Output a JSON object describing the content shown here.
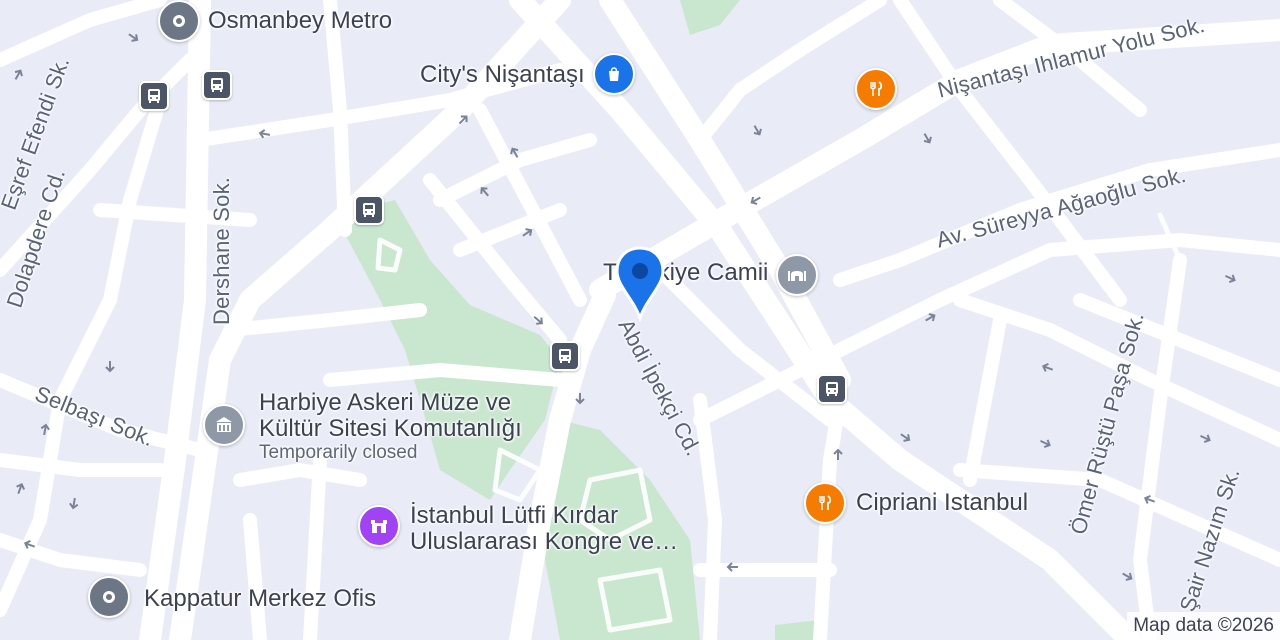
{
  "map": {
    "colors": {
      "background": "#e9ebf7",
      "road": "#ffffff",
      "park": "#c9e6cf",
      "marker": "#1a73e8",
      "transit": "#4b5565",
      "restaurant": "#f57c00",
      "shopping": "#1a73e8",
      "landmark": "#9e9e9e",
      "event_venue": "#a142f4",
      "place": "#6c7684"
    },
    "street_labels": [
      {
        "text": "Nişantaşı Ihlamur Yolu Sok."
      },
      {
        "text": "Av. Süreyya Ağaoğlu Sok."
      },
      {
        "text": "Eşref Efendi Sk."
      },
      {
        "text": "Dolapdere Cd."
      },
      {
        "text": "Dershane Sok."
      },
      {
        "text": "Selbaşı Sok."
      },
      {
        "text": "Abdi İpekçi Cd."
      },
      {
        "text": "Ömer Rüştü Paşa Sok."
      },
      {
        "text": "Şair Nazım Sk."
      }
    ],
    "pois": [
      {
        "name": "Osmanbey Metro",
        "subtitle": "",
        "icon": "place-icon",
        "category": "place"
      },
      {
        "name": "City's Nişantaşı",
        "subtitle": "",
        "icon": "shopping-bag-icon",
        "category": "shopping"
      },
      {
        "name": "Teşvikiye Camii",
        "subtitle": "",
        "icon": "mosque-icon",
        "category": "landmark"
      },
      {
        "name_line1": "Harbiye Askeri Müze ve",
        "name_line2": "Kültür Sitesi Komutanlığı",
        "subtitle": "Temporarily closed",
        "icon": "museum-icon",
        "category": "landmark"
      },
      {
        "name_line1": "İstanbul Lütfi Kırdar",
        "name_line2": "Uluslararası Kongre ve…",
        "subtitle": "",
        "icon": "event-venue-icon",
        "category": "event_venue"
      },
      {
        "name": "Cipriani Istanbul",
        "subtitle": "",
        "icon": "restaurant-icon",
        "category": "restaurant"
      },
      {
        "name": "",
        "subtitle": "",
        "icon": "restaurant-icon",
        "category": "restaurant"
      },
      {
        "name": "Kappatur Merkez Ofis",
        "subtitle": "",
        "icon": "place-icon",
        "category": "place"
      }
    ],
    "attribution": "Map data ©2026",
    "selected_marker": {
      "icon": "location-pin-icon"
    }
  }
}
